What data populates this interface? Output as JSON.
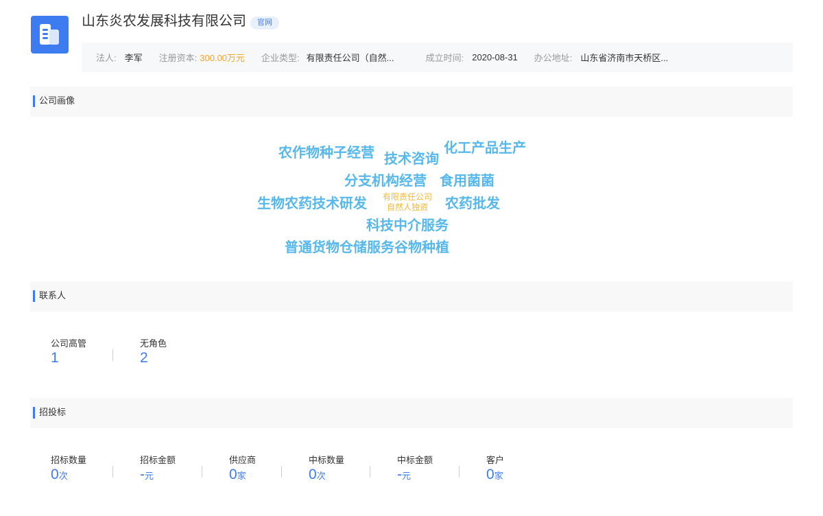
{
  "company": {
    "name": "山东炎农发展科技有限公司",
    "official_tag": "官网",
    "logo_icon": "building-icon"
  },
  "info": {
    "legal_person_label": "法人:",
    "legal_person": "李军",
    "capital_label": "注册资本:",
    "capital": "300.00万元",
    "type_label": "企业类型:",
    "type": "有限责任公司（自然...",
    "founded_label": "成立时间:",
    "founded": "2020-08-31",
    "address_label": "办公地址:",
    "address": "山东省济南市天桥区..."
  },
  "sections": {
    "profile": "公司画像",
    "contacts": "联系人",
    "bidding": "招投标"
  },
  "tags": {
    "crop_seed": "农作物种子经营",
    "tech_consult": "技术咨询",
    "chem_production": "化工产品生产",
    "branch": "分支机构经营",
    "fungi": "食用菌菌",
    "biopesticide": "生物农药技术研发",
    "company_type_1": "有限责任公司",
    "company_type_2": "自然人独资",
    "pesticide_wholesale": "农药批发",
    "tech_intermediary": "科技中介服务",
    "storage_grain": "普通货物仓储服务谷物种植"
  },
  "contacts": {
    "executives_label": "公司高管",
    "executives_count": "1",
    "no_role_label": "无角色",
    "no_role_count": "2"
  },
  "bidding": {
    "tender_count_label": "招标数量",
    "tender_count": "0",
    "tender_count_unit": "次",
    "tender_amount_label": "招标金额",
    "tender_amount": "-",
    "tender_amount_unit": "元",
    "supplier_label": "供应商",
    "supplier": "0",
    "supplier_unit": "家",
    "win_count_label": "中标数量",
    "win_count": "0",
    "win_count_unit": "次",
    "win_amount_label": "中标金额",
    "win_amount": "-",
    "win_amount_unit": "元",
    "customer_label": "客户",
    "customer": "0",
    "customer_unit": "家"
  }
}
